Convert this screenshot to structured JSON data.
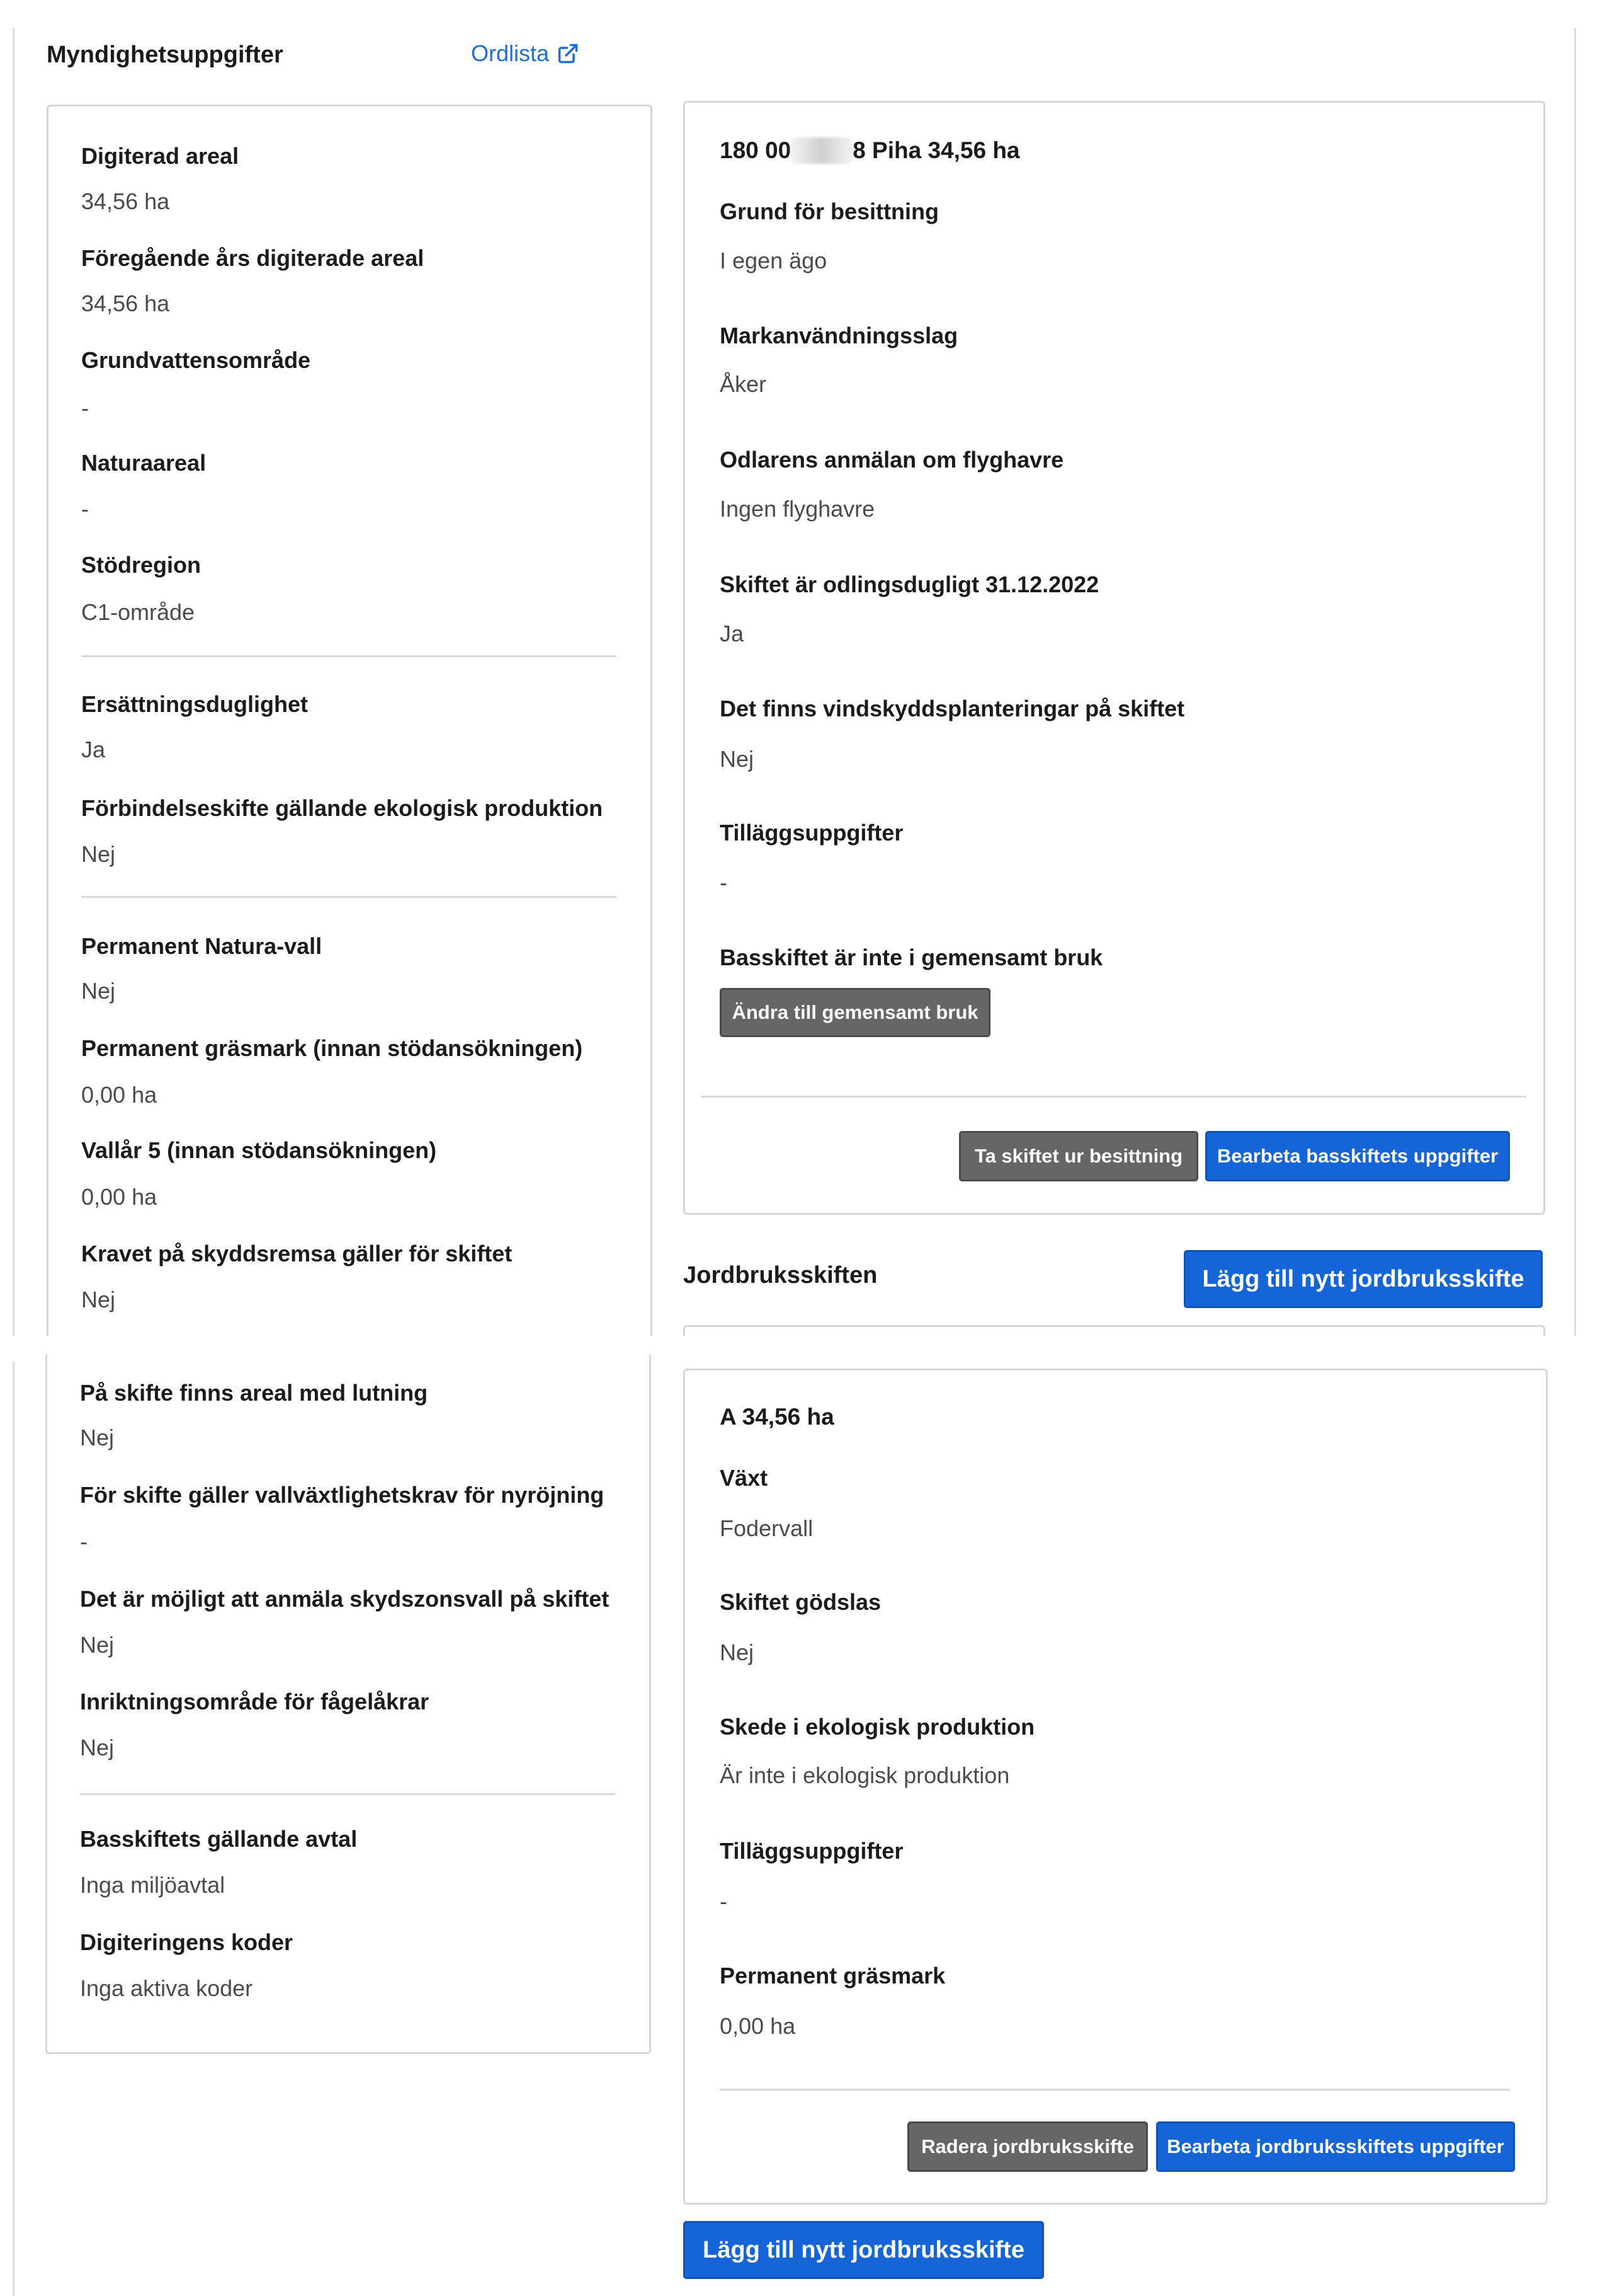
{
  "header": {
    "title": "Myndighetsuppgifter",
    "glossary_link": "Ordlista"
  },
  "left_card_top": {
    "fields": [
      {
        "label": "Digiterad areal",
        "value": "34,56 ha"
      },
      {
        "label": "Föregående års digiterade areal",
        "value": "34,56 ha"
      },
      {
        "label": "Grundvattensområde",
        "value": "-"
      },
      {
        "label": "Naturaareal",
        "value": "-"
      },
      {
        "label": "Stödregion",
        "value": "C1-område"
      },
      {
        "label": "Ersättningsduglighet",
        "value": "Ja"
      },
      {
        "label": "Förbindelseskifte gällande ekologisk produktion",
        "value": "Nej"
      },
      {
        "label": "Permanent Natura-vall",
        "value": "Nej"
      },
      {
        "label": "Permanent gräsmark (innan stödansökningen)",
        "value": "0,00 ha"
      },
      {
        "label": "Vallår 5 (innan stödansökningen)",
        "value": "0,00 ha"
      },
      {
        "label": "Kravet på skyddsremsa gäller för skiftet",
        "value": "Nej"
      }
    ]
  },
  "left_card_bottom": {
    "fields": [
      {
        "label": "På skifte finns areal med lutning",
        "value": "Nej"
      },
      {
        "label": "För skifte gäller vallväxtlighetskrav för nyröjning",
        "value": "-"
      },
      {
        "label": "Det är möjligt att anmäla skydszonsvall på skiftet",
        "value": "Nej"
      },
      {
        "label": "Inriktningsområde för fågelåkrar",
        "value": "Nej"
      },
      {
        "label": "Basskiftets gällande avtal",
        "value": "Inga miljöavtal"
      },
      {
        "label": "Digiteringens koder",
        "value": "Inga aktiva koder"
      }
    ]
  },
  "base_parcel": {
    "title_prefix": "180 00",
    "title_suffix": "8 Piha 34,56 ha",
    "fields": [
      {
        "label": "Grund för besittning",
        "value": "I egen ägo"
      },
      {
        "label": "Markanvändningsslag",
        "value": "Åker"
      },
      {
        "label": "Odlarens anmälan om flyghavre",
        "value": "Ingen flyghavre"
      },
      {
        "label": "Skiftet är odlingsdugligt 31.12.2022",
        "value": "Ja"
      },
      {
        "label": "Det finns vindskyddsplanteringar på skiftet",
        "value": "Nej"
      },
      {
        "label": "Tilläggsuppgifter",
        "value": "-"
      },
      {
        "label": "Basskiftet är inte i gemensamt bruk",
        "value": ""
      }
    ],
    "common_use_button": "Ändra till gemensamt bruk",
    "remove_button": "Ta skiftet ur besittning",
    "edit_button": "Bearbeta basskiftets uppgifter"
  },
  "agri_section": {
    "title": "Jordbruksskiften",
    "add_button": "Lägg till nytt jordbruksskifte"
  },
  "agri_parcel": {
    "title": "A 34,56 ha",
    "fields": [
      {
        "label": "Växt",
        "value": "Fodervall"
      },
      {
        "label": "Skiftet gödslas",
        "value": "Nej"
      },
      {
        "label": "Skede i ekologisk produktion",
        "value": "Är inte i ekologisk produktion"
      },
      {
        "label": "Tilläggsuppgifter",
        "value": "-"
      },
      {
        "label": "Permanent gräsmark",
        "value": "0,00 ha"
      }
    ],
    "delete_button": "Radera jordbruksskifte",
    "edit_button": "Bearbeta jordbruksskiftets uppgifter"
  },
  "bottom_add_button": "Lägg till nytt jordbruksskifte",
  "colors": {
    "primary": "#1565d8",
    "secondary": "#666666",
    "link": "#1f6fd1",
    "border": "#d6d6d6"
  }
}
